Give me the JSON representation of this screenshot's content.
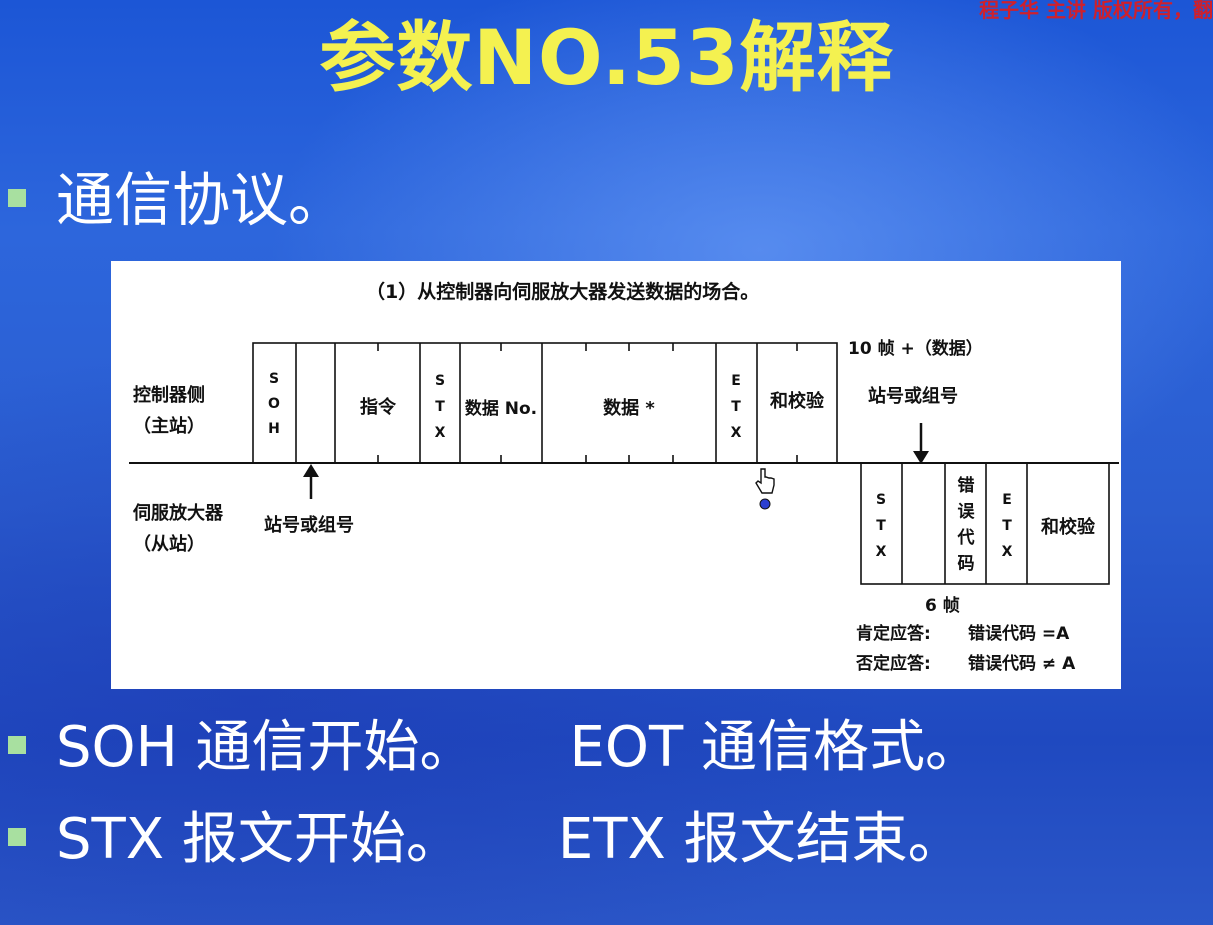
{
  "watermark": "程子华 主讲 版权所有，翻",
  "title": "参数NO.53解释",
  "bullets": {
    "protocol": "通信协议。",
    "soh": "SOH 通信开始。",
    "eot": "EOT 通信格式。",
    "stx": "STX 报文开始。",
    "etx": "ETX 报文结束。"
  },
  "diagram": {
    "caption": "（1）从控制器向伺服放大器发送数据的场合。",
    "controller_label_1": "控制器侧",
    "controller_label_2": "（主站）",
    "servo_label_1": "伺服放大器",
    "servo_label_2": "（从站）",
    "station_label_left": "站号或组号",
    "station_label_right": "站号或组号",
    "frames_top": "10 帧 +（数据）",
    "frames_bottom": "6 帧",
    "positive": "肯定应答:",
    "positive_value": "错误代码 =A",
    "negative": "否定应答:",
    "negative_value": "错误代码 ≠ A",
    "top_fields": {
      "soh": [
        "S",
        "O",
        "H"
      ],
      "command": "指令",
      "stx": [
        "S",
        "T",
        "X"
      ],
      "data_no": "数据 No.",
      "data": "数据 *",
      "etx": [
        "E",
        "T",
        "X"
      ],
      "checksum": "和校验"
    },
    "bottom_fields": {
      "stx": [
        "S",
        "T",
        "X"
      ],
      "error_code": [
        "错",
        "误",
        "代",
        "码"
      ],
      "etx": [
        "E",
        "T",
        "X"
      ],
      "checksum": "和校验"
    }
  }
}
